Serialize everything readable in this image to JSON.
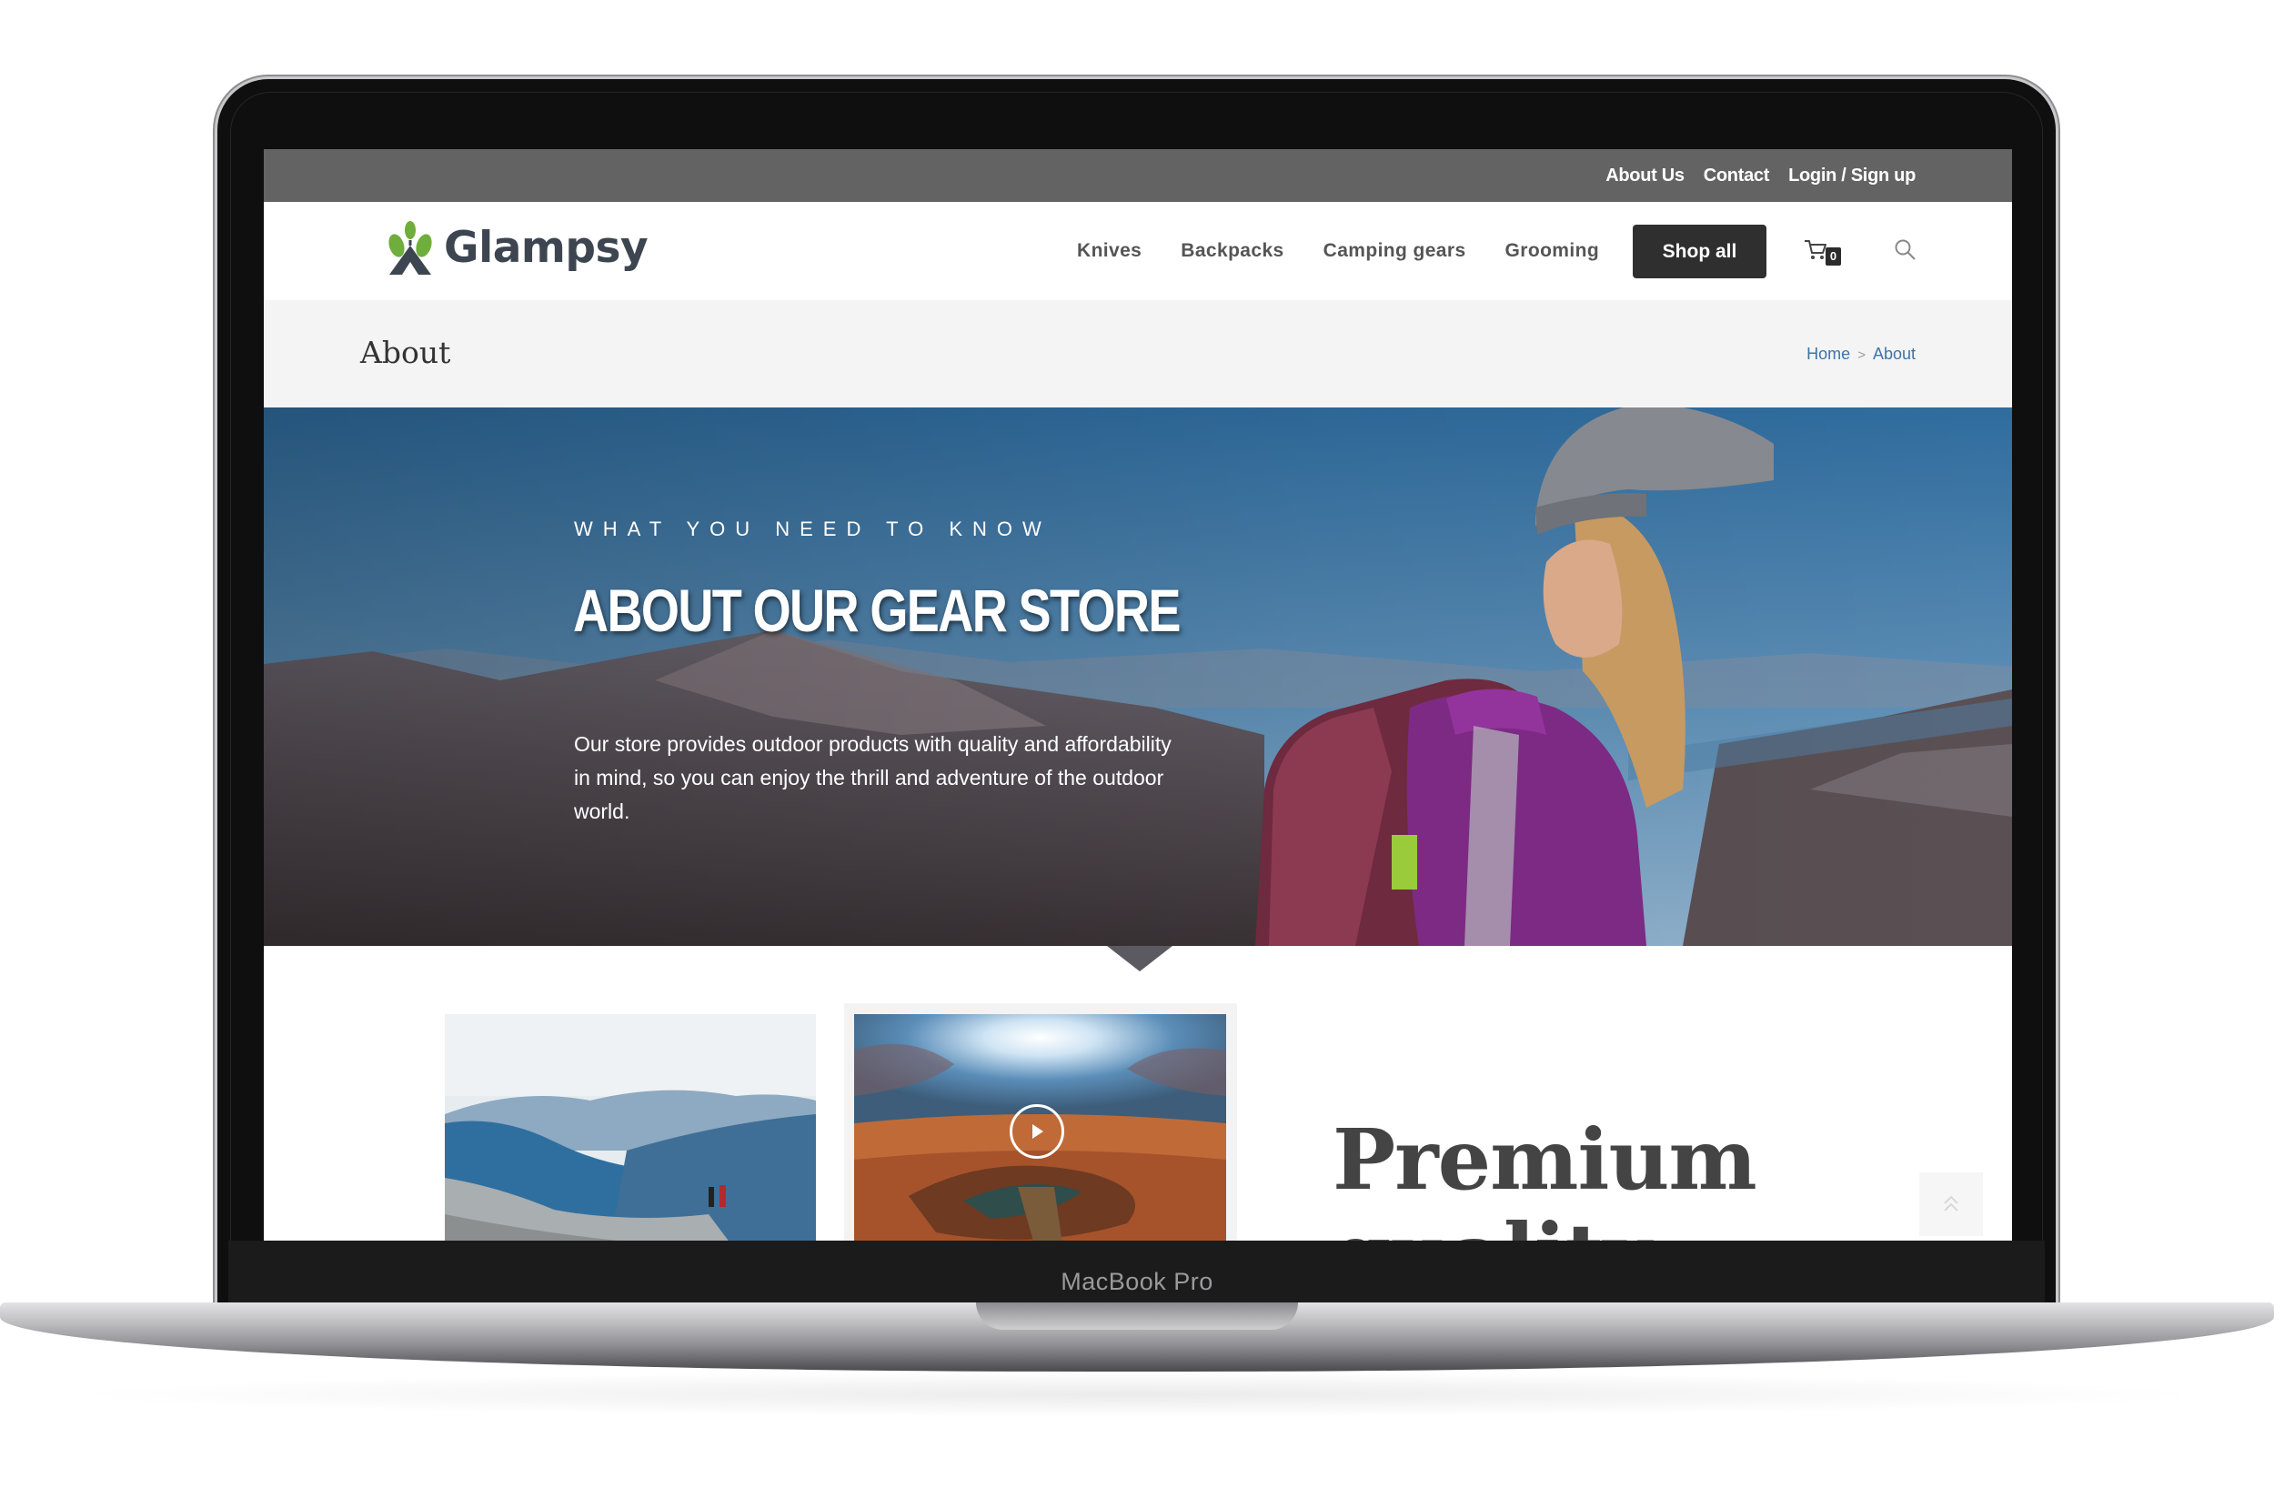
{
  "device": {
    "label": "MacBook Pro"
  },
  "topbar": {
    "links": [
      "About Us",
      "Contact",
      "Login / Sign up"
    ]
  },
  "header": {
    "logo_text": "Glampsy",
    "nav": [
      "Knives",
      "Backpacks",
      "Camping gears",
      "Grooming"
    ],
    "shop_button": "Shop all",
    "cart_count": "0",
    "icons": [
      "cart-icon",
      "search-icon"
    ]
  },
  "page": {
    "title": "About",
    "breadcrumb": [
      "Home",
      "About"
    ],
    "breadcrumb_separator": ">"
  },
  "hero": {
    "eyebrow": "WHAT YOU NEED TO KNOW",
    "title": "ABOUT OUR GEAR STORE",
    "body": "Our store provides outdoor products with quality and affordability in mind, so you can enjoy the thrill and adventure of the outdoor world."
  },
  "content": {
    "heading_lines": [
      "Premium",
      "quality"
    ]
  },
  "colors": {
    "topbar": "#636363",
    "shop_button": "#2f2f2f",
    "breadcrumb_link": "#3f73a8",
    "titlebar_bg": "#f4f4f4",
    "logo_green": "#6fae3c",
    "logo_dark": "#3d4650"
  }
}
